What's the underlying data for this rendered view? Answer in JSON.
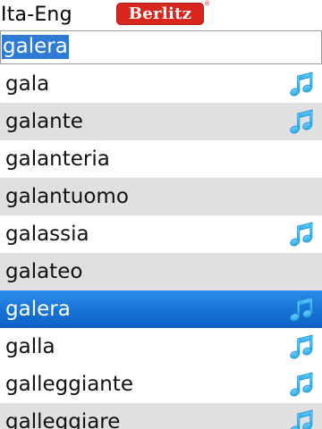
{
  "header": {
    "title": "Ita-Eng",
    "logo_text": "Berlitz",
    "logo_mark": "®"
  },
  "search": {
    "value": "galera"
  },
  "colors": {
    "selection": "#1872d6",
    "alt_row": "#e0e0e0",
    "logo": "#d9261c",
    "audio_icon": "#2aa9e8"
  },
  "entries": [
    {
      "word": "gala",
      "audio": true
    },
    {
      "word": "galante",
      "audio": true
    },
    {
      "word": "galanteria",
      "audio": false
    },
    {
      "word": "galantuomo",
      "audio": false
    },
    {
      "word": "galassia",
      "audio": true
    },
    {
      "word": "galateo",
      "audio": false
    },
    {
      "word": "galera",
      "audio": true,
      "selected": true
    },
    {
      "word": "galla",
      "audio": true
    },
    {
      "word": "galleggiante",
      "audio": true
    },
    {
      "word": "galleggiare",
      "audio": true
    }
  ],
  "icons": {
    "audio": "music-note-icon"
  }
}
